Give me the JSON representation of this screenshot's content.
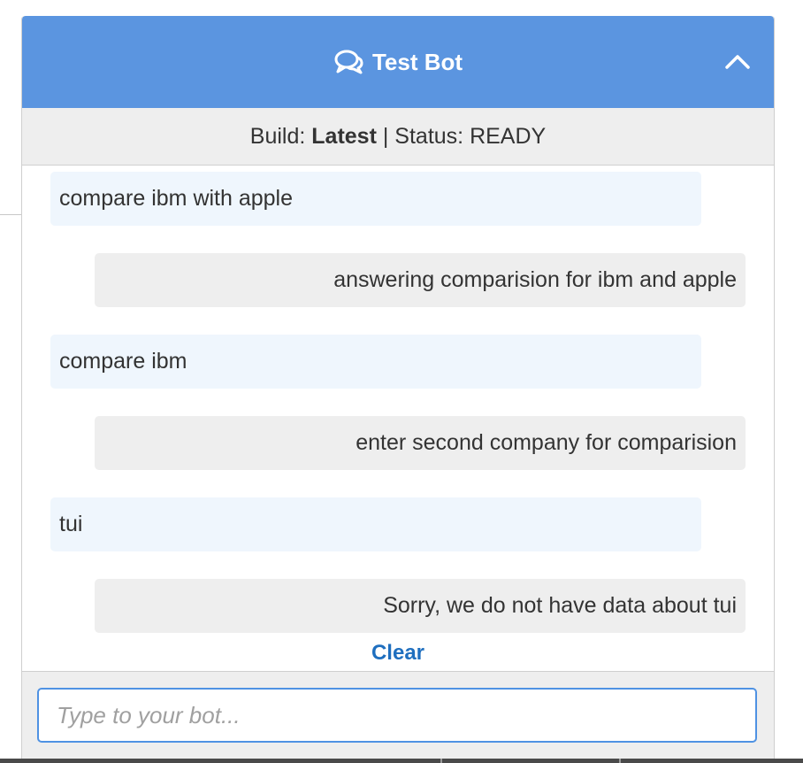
{
  "header": {
    "title": "Test Bot",
    "chat_icon": "chat-bubbles-icon",
    "collapse_icon": "chevron-up-icon"
  },
  "status": {
    "build_label": "Build: ",
    "build_value": "Latest",
    "separator": " | ",
    "status_label": "Status: ",
    "status_value": "READY"
  },
  "messages": [
    {
      "role": "user",
      "text": "compare ibm with apple"
    },
    {
      "role": "bot",
      "text": "answering comparision for ibm and apple"
    },
    {
      "role": "user",
      "text": "compare ibm"
    },
    {
      "role": "bot",
      "text": "enter second company for comparision"
    },
    {
      "role": "user",
      "text": "tui"
    },
    {
      "role": "bot",
      "text": "Sorry, we do not have data about tui"
    }
  ],
  "clear_label": "Clear",
  "input": {
    "placeholder": "Type to your bot...",
    "value": ""
  },
  "colors": {
    "header_bg": "#5b95e0",
    "user_bubble": "#eff6fd",
    "bot_bubble": "#eeeeee",
    "link": "#1f6fbf"
  }
}
